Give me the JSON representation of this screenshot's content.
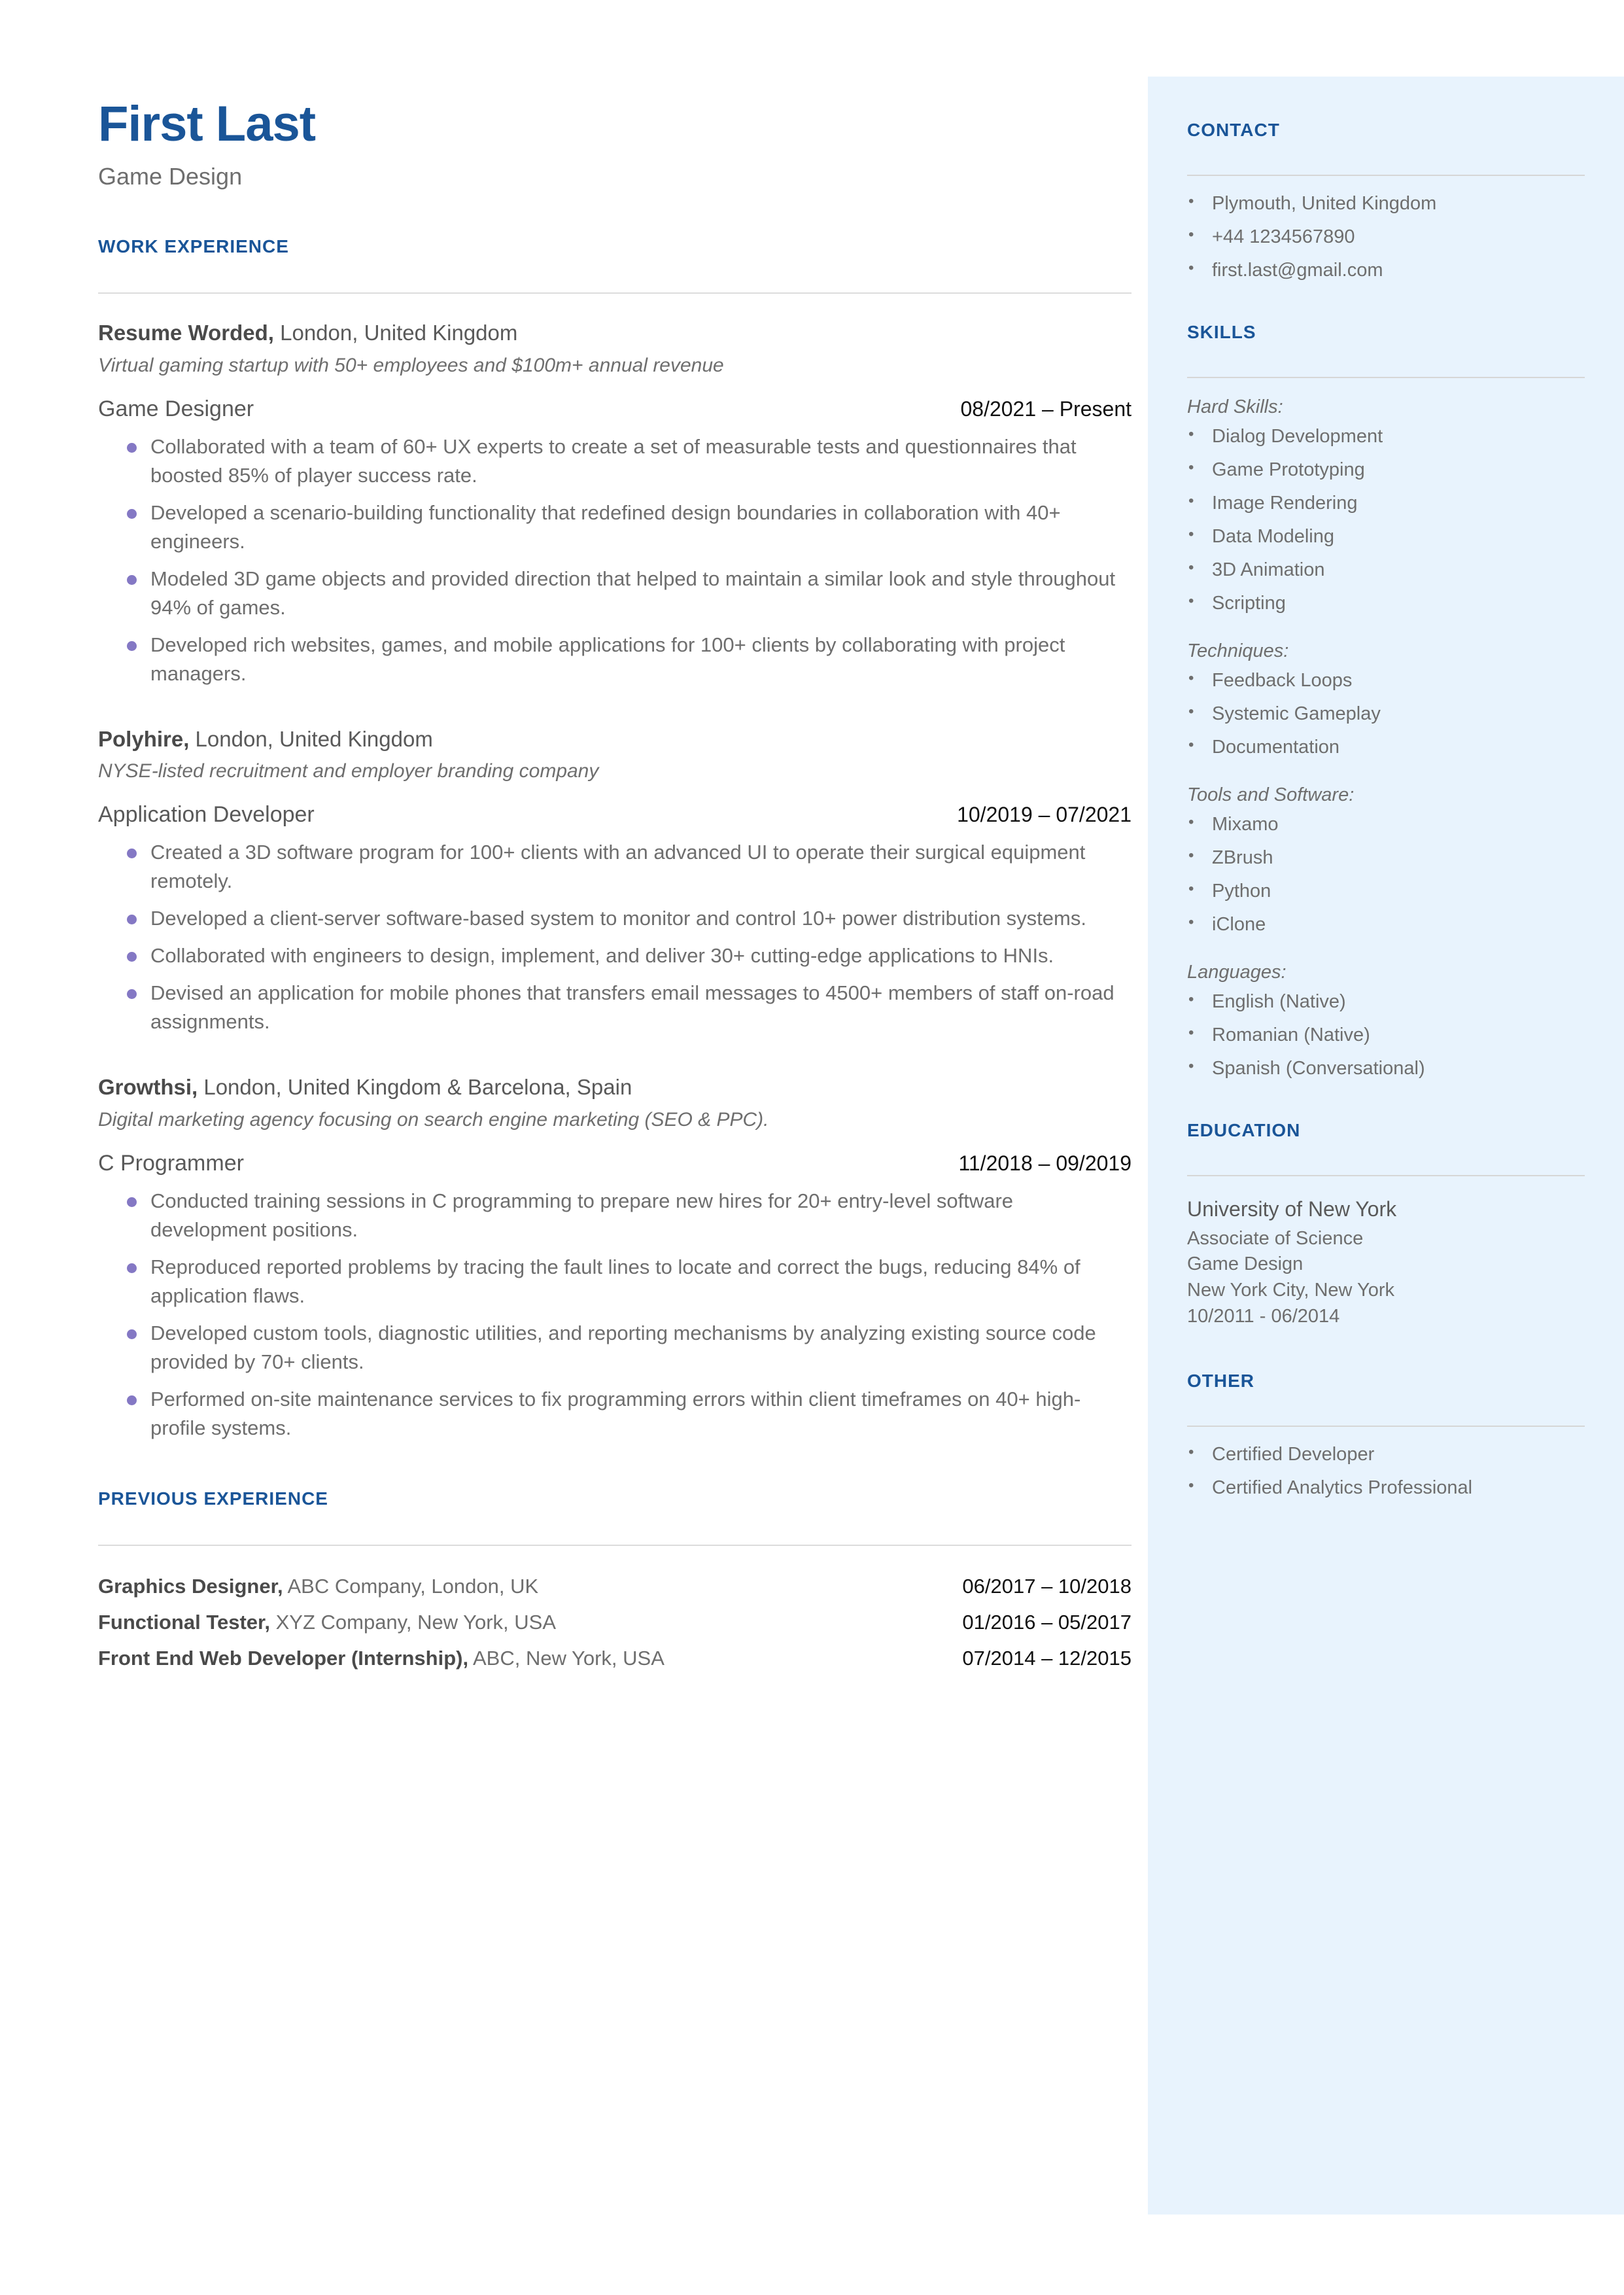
{
  "header": {
    "name": "First Last",
    "tagline": "Game Design"
  },
  "main": {
    "work_experience_heading": "WORK EXPERIENCE",
    "previous_experience_heading": "PREVIOUS EXPERIENCE",
    "jobs": [
      {
        "company": "Resume Worded,",
        "location": " London, United Kingdom",
        "description": "Virtual gaming startup with 50+ employees and $100m+ annual revenue",
        "role": "Game Designer",
        "dates": "08/2021 – Present",
        "bullets": [
          "Collaborated with a team of 60+ UX experts to create a set of measurable tests and questionnaires that boosted 85% of player success rate.",
          "Developed a scenario-building functionality that redefined design boundaries in collaboration with 40+ engineers.",
          "Modeled 3D game objects and provided direction that helped to maintain a similar look and style throughout 94% of games.",
          "Developed rich websites, games, and mobile applications for 100+ clients by collaborating with project managers."
        ]
      },
      {
        "company": "Polyhire,",
        "location": " London, United Kingdom",
        "description": "NYSE-listed recruitment and employer branding company",
        "role": "Application Developer",
        "dates": "10/2019 – 07/2021",
        "bullets": [
          "Created a 3D software program for 100+ clients with an advanced UI to operate their surgical equipment remotely.",
          "Developed a client-server software-based system to monitor and control 10+ power distribution systems.",
          "Collaborated with engineers to design, implement, and deliver 30+ cutting-edge applications to HNIs.",
          "Devised an application for mobile phones that transfers email messages to 4500+ members of staff on-road assignments."
        ]
      },
      {
        "company": "Growthsi,",
        "location": " London, United Kingdom & Barcelona, Spain",
        "description": "Digital marketing agency focusing on search engine marketing (SEO & PPC).",
        "role": "C Programmer",
        "dates": "11/2018 – 09/2019",
        "bullets": [
          "Conducted training sessions in C programming to prepare new hires for 20+ entry-level software development positions.",
          "Reproduced reported problems by tracing the fault lines to locate and correct the bugs, reducing 84% of application flaws.",
          "Developed custom tools, diagnostic utilities, and reporting mechanisms by analyzing existing source code provided by 70+ clients.",
          "Performed on-site maintenance services to fix programming errors within client timeframes on 40+ high-profile systems."
        ]
      }
    ],
    "previous_experience": [
      {
        "title": "Graphics Designer,",
        "detail": " ABC Company, London, UK",
        "dates": "06/2017 – 10/2018"
      },
      {
        "title": "Functional Tester,",
        "detail": " XYZ Company, New York, USA",
        "dates": "01/2016 – 05/2017"
      },
      {
        "title": "Front End Web Developer (Internship),",
        "detail": " ABC, New York, USA",
        "dates": "07/2014 – 12/2015"
      }
    ]
  },
  "sidebar": {
    "contact_heading": "CONTACT",
    "contact_items": [
      " Plymouth, United Kingdom",
      "+44 1234567890",
      "first.last@gmail.com"
    ],
    "skills_heading": "SKILLS",
    "skill_groups": [
      {
        "label": "Hard Skills:",
        "items": [
          "Dialog Development",
          "Game Prototyping",
          "Image Rendering",
          "Data Modeling",
          "3D Animation",
          "Scripting"
        ]
      },
      {
        "label": "Techniques:",
        "items": [
          "Feedback Loops",
          "Systemic Gameplay",
          "Documentation"
        ]
      },
      {
        "label": "Tools and Software:",
        "items": [
          "Mixamo",
          "ZBrush",
          "Python",
          "iClone"
        ]
      },
      {
        "label": "Languages:",
        "items": [
          "English (Native)",
          "Romanian (Native)",
          "Spanish (Conversational)"
        ]
      }
    ],
    "education_heading": "EDUCATION",
    "education": {
      "school": "University of New York",
      "degree": "Associate of Science",
      "field": "Game Design",
      "location": "New York City, New York",
      "dates": "10/2011 - 06/2014"
    },
    "other_heading": "OTHER",
    "other_items": [
      "Certified Developer",
      "Certified Analytics Professional"
    ]
  },
  "colors": {
    "accent_blue": "#1a5598",
    "sidebar_bg": "#e8f3fd",
    "bullet_purple": "#8478c4",
    "body_gray": "#6e6e6e",
    "date_black": "#111111"
  }
}
